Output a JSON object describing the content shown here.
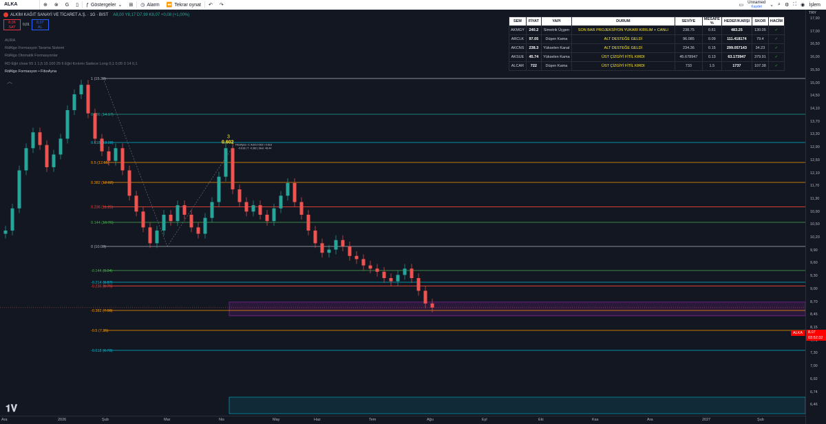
{
  "topbar": {
    "symbol": "ALKA",
    "add_icon": "plus-circle-icon",
    "interval": "G",
    "indicators_label": "Göstergeler",
    "alarm_label": "Alarm",
    "replay_label": "Tekrar oynat",
    "account_name": "Unnamed",
    "account_status": "Kaydet",
    "trade_label": "İşlem"
  },
  "legend": {
    "title": "ALKİM KAĞIT SANAYİ VE TİCARET A.Ş. · 1G · BIST",
    "ohlc": "A8,00 Y8,17 D7,99 K8,07 +0,08 (+1,00%)",
    "sell_price": "8,06",
    "sell_label": "SAT",
    "spread": "0,01",
    "buy_price": "8,07",
    "buy_label": "AL",
    "indicators": [
      "AURA",
      "RdAlgo Formasyon Tarama Sistemi",
      "RdAlgo Otomatik Formasyonlar",
      "RD Eğri close 55 1 1,5 15 100 25 6 Eğri Kırılımı Sadece Long 0,1 0,05 0 14 0,1",
      "RdAlgo Formasyon • FiboAyna"
    ]
  },
  "table": {
    "headers": [
      "SEM",
      "FİYAT",
      "YAPI",
      "DURUM",
      "SEVİYE",
      "MESAFE %",
      "HEDEF/KARŞI",
      "SKOR",
      "HACİM"
    ],
    "rows": [
      [
        "AKMGY",
        "240.2",
        "Simetrik Üçgen",
        "SON BAR PROJEKSİYON YUKARI KIRILIM + CANLI",
        "238.75",
        "0.61",
        "483.25",
        "130.05",
        "✓"
      ],
      [
        "ARCLK",
        "97.05",
        "Düşen Kama",
        "ALT DESTEĞE GELDİ",
        "96.085",
        "0.09",
        "111.418174",
        "79.4",
        "✓"
      ],
      [
        "AKCNS",
        "238.3",
        "Yükselen Kanal",
        "ALT DESTEĞE GELDİ",
        "234.36",
        "0.15",
        "299.057143",
        "34.23",
        "✓"
      ],
      [
        "AKSUE",
        "45.74",
        "Yükselen Kama",
        "ÜST ÇİZGİYİ FİTİL KIRDI",
        "45.678947",
        "0.13",
        "63.173947",
        "379.91",
        "✓"
      ],
      [
        "ALCAR",
        "722",
        "Düşen Kama",
        "ÜST ÇİZGİYİ FİTİL KIRDI",
        "733",
        "1.5",
        "1737",
        "107.38",
        "✓"
      ]
    ]
  },
  "price_axis": {
    "currency": "TRY",
    "ticks": [
      "17,90",
      "17,00",
      "16,50",
      "16,00",
      "15,50",
      "15,00",
      "14,50",
      "14,10",
      "13,70",
      "13,30",
      "12,90",
      "12,50",
      "12,10",
      "11,70",
      "11,30",
      "10,90",
      "10,50",
      "10,20",
      "9,90",
      "9,60",
      "9,30",
      "9,00",
      "8,70",
      "8,45",
      "8,15",
      "7,70",
      "7,30",
      "7,00",
      "6,92",
      "6,74",
      "6,46"
    ],
    "current_symbol": "ALKA",
    "current_price": "8,07",
    "countdown": "03:52:32"
  },
  "time_axis": {
    "labels": [
      "Ara",
      "2026",
      "Şub",
      "Mar",
      "Nis",
      "May",
      "Haz",
      "Tem",
      "Ağu",
      "Eyl",
      "Eki",
      "Kas",
      "Ara",
      "2027",
      "Şub"
    ]
  },
  "fib_levels": [
    {
      "label": "1 (15.30)",
      "value": 15.3,
      "color": "#b2b5be"
    },
    {
      "label": "0.786 (14.17)",
      "value": 14.17,
      "color": "#26a69a"
    },
    {
      "label": "0.618 (13.28)",
      "value": 13.28,
      "color": "#00bcd4"
    },
    {
      "label": "0.5 (12.65)",
      "value": 12.65,
      "color": "#ff9800"
    },
    {
      "label": "0.382 (12.02)",
      "value": 12.02,
      "color": "#ff9800"
    },
    {
      "label": "0.236 (11.25)",
      "value": 11.25,
      "color": "#f44336"
    },
    {
      "label": "0.144 (10.76)",
      "value": 10.76,
      "color": "#4caf50"
    },
    {
      "label": "0 (10.00)",
      "value": 10.0,
      "color": "#b2b5be"
    },
    {
      "label": "-0.144 (9.24)",
      "value": 9.24,
      "color": "#4caf50"
    },
    {
      "label": "-0.214 (8.87)",
      "value": 8.87,
      "color": "#00bcd4"
    },
    {
      "label": "-0.236 (8.75)",
      "value": 8.75,
      "color": "#f44336"
    },
    {
      "label": "-0.382 (7.98)",
      "value": 7.98,
      "color": "#ff9800"
    },
    {
      "label": "-0.5 (7.35)",
      "value": 7.35,
      "color": "#ff9800"
    },
    {
      "label": "-0.618 (6.72)",
      "value": 6.72,
      "color": "#00bcd4"
    }
  ],
  "annotation": {
    "point_label": "3",
    "point_value": "0.602",
    "info_line1": "FiboAyna • 3. Adım 0.602 • 0.618",
    "info_line2": "-0.618 | T: -0.382 | Skor: 48.44"
  },
  "colors": {
    "up": "#26a69a",
    "down": "#ef5350",
    "zone": "#9c27b0",
    "zone2": "#00bcd4"
  },
  "chart_data": {
    "type": "candlestick",
    "series": [
      {
        "name": "ALKA",
        "values": [
          10.5,
          11.2,
          12.4,
          13.1,
          13.6,
          13.2,
          12.5,
          12.9,
          13.4,
          14.3,
          14.8,
          15.1,
          14.2,
          13.4,
          13.0,
          12.7,
          13.1,
          12.4,
          11.6,
          11.1,
          10.6,
          10.1,
          10.5,
          11.0,
          10.8,
          11.3,
          11.0,
          10.6,
          10.4,
          10.9,
          11.4,
          12.2,
          13.1,
          11.8,
          11.4,
          11.1,
          11.3,
          11.0,
          10.8,
          11.2,
          11.6,
          12.0,
          11.4,
          11.0,
          10.5,
          10.1,
          9.8,
          9.9,
          10.2,
          10.0,
          9.7,
          9.6,
          9.4,
          9.3,
          9.2,
          9.0,
          8.9,
          9.1,
          9.3,
          9.0,
          8.6,
          8.2,
          8.07
        ]
      }
    ]
  }
}
